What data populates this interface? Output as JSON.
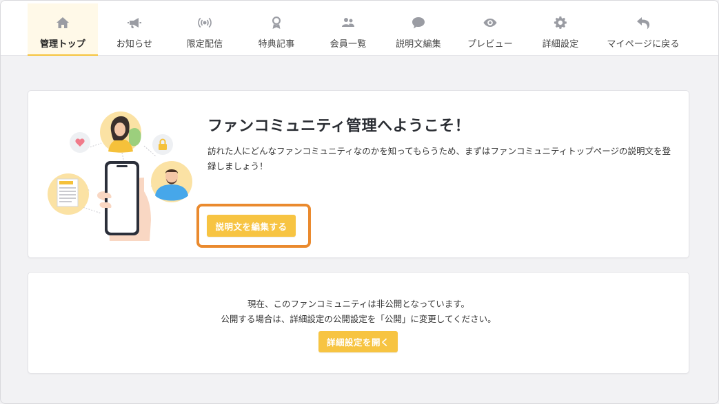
{
  "nav": {
    "items": [
      {
        "label": "管理トップ",
        "icon": "home-icon",
        "active": true
      },
      {
        "label": "お知らせ",
        "icon": "megaphone-icon",
        "active": false
      },
      {
        "label": "限定配信",
        "icon": "broadcast-icon",
        "active": false
      },
      {
        "label": "特典記事",
        "icon": "award-icon",
        "active": false
      },
      {
        "label": "会員一覧",
        "icon": "users-icon",
        "active": false
      },
      {
        "label": "説明文編集",
        "icon": "speech-bubble-icon",
        "active": false
      },
      {
        "label": "プレビュー",
        "icon": "eye-icon",
        "active": false
      },
      {
        "label": "詳細設定",
        "icon": "gear-icon",
        "active": false
      },
      {
        "label": "マイページに戻る",
        "icon": "back-arrow-icon",
        "active": false
      }
    ]
  },
  "welcome": {
    "title": "ファンコミュニティ管理へようこそ！",
    "description": "訪れた人にどんなファンコミュニティなのかを知ってもらうため、まずはファンコミュニティトップページの説明文を登録しましょう！",
    "edit_button": "説明文を編集する"
  },
  "status": {
    "line1": "現在、このファンコミュニティは非公開となっています。",
    "line2": "公開する場合は、詳細設定の公開設定を「公開」に変更してください。",
    "open_settings_button": "詳細設定を開く"
  },
  "colors": {
    "accent": "#f7c442",
    "highlight": "#ea8a2e",
    "active_tab_bg": "#fff9e8"
  }
}
